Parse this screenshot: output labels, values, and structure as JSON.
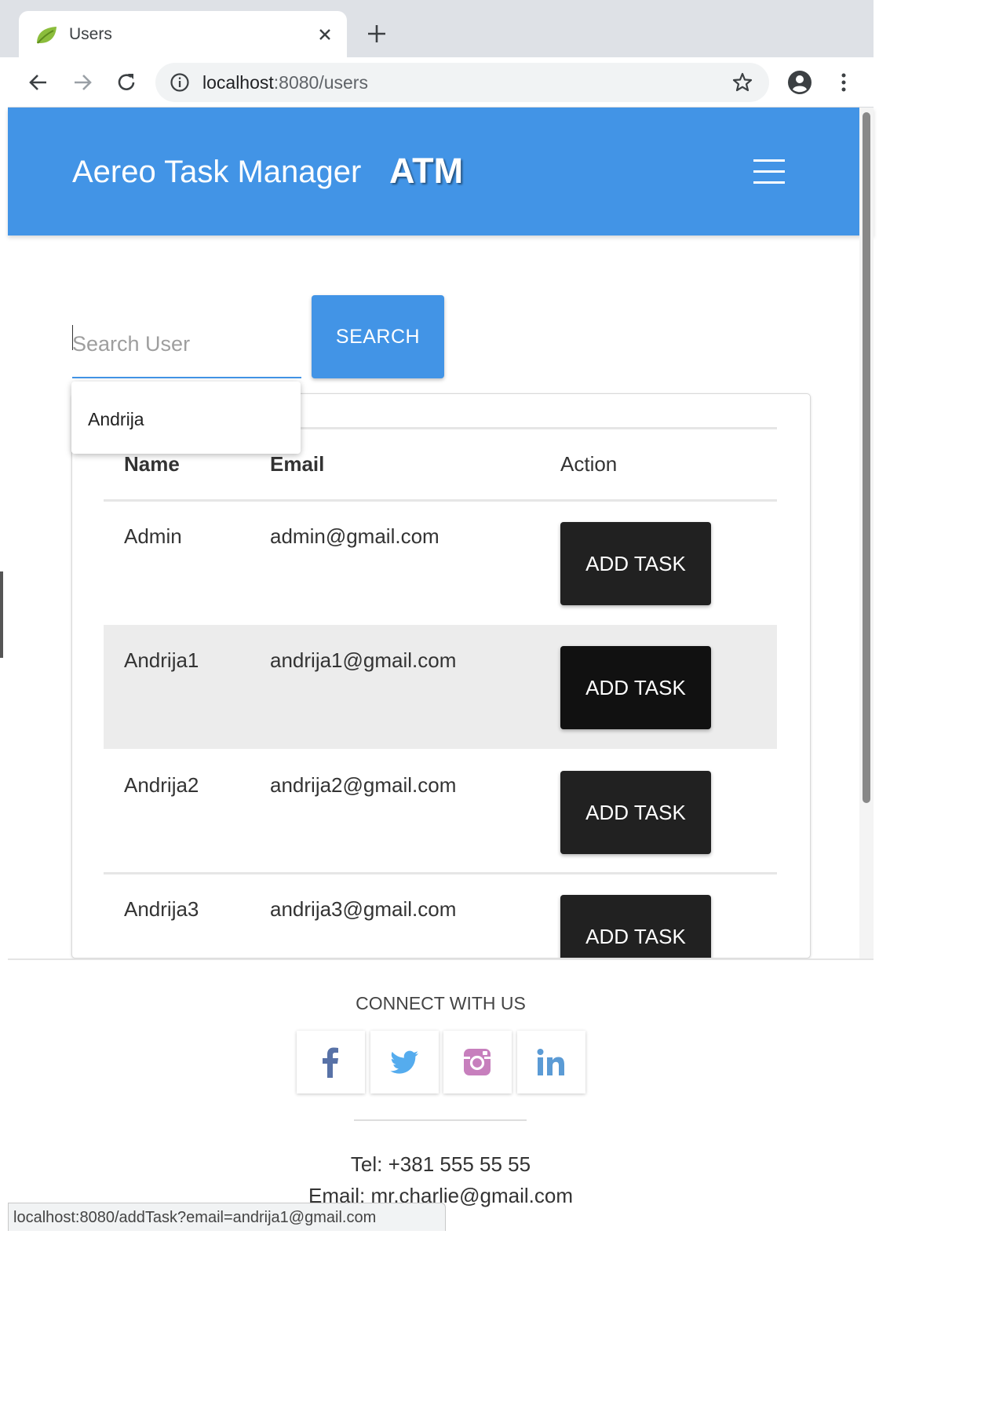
{
  "browser": {
    "tab_title": "Users",
    "url_host": "localhost",
    "url_rest": ":8080/users",
    "status_url": "localhost:8080/addTask?email=andrija1@gmail.com"
  },
  "navbar": {
    "brand": "Aereo Task Manager",
    "brand_short": "ATM"
  },
  "search": {
    "placeholder": "Search User",
    "button_label": "SEARCH",
    "suggestion": "Andrija"
  },
  "table": {
    "headers": [
      "Name",
      "Email",
      "Action"
    ],
    "rows": [
      {
        "name": "Admin",
        "email": "admin@gmail.com",
        "action": "ADD TASK"
      },
      {
        "name": "Andrija1",
        "email": "andrija1@gmail.com",
        "action": "ADD TASK"
      },
      {
        "name": "Andrija2",
        "email": "andrija2@gmail.com",
        "action": "ADD TASK"
      },
      {
        "name": "Andrija3",
        "email": "andrija3@gmail.com",
        "action": "ADD TASK"
      }
    ]
  },
  "footer": {
    "connect": "CONNECT WITH US",
    "social": [
      "facebook-icon",
      "twitter-icon",
      "instagram-icon",
      "linkedin-icon"
    ],
    "tel": "Tel: +381 555 55 55",
    "email": "Email: mr.charlie@gmail.com"
  },
  "colors": {
    "primary": "#4294e6",
    "button_dark": "#212121",
    "row_highlight": "#ececec"
  }
}
